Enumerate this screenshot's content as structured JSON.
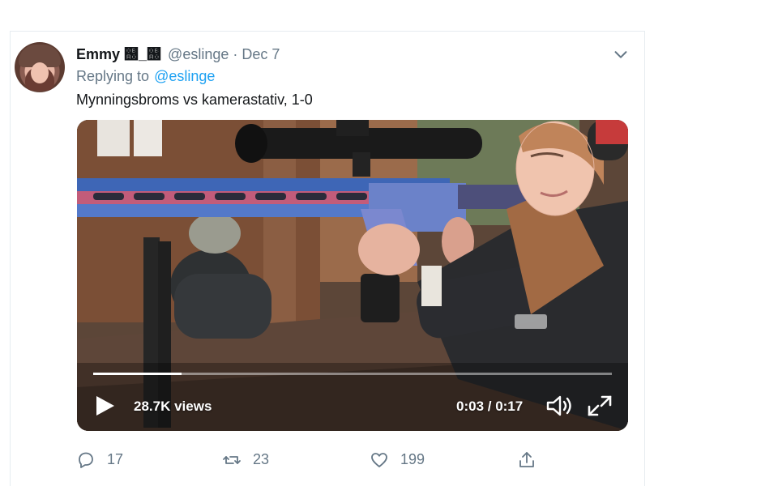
{
  "tweet": {
    "author_name": "Emmy ஠_஠",
    "author_handle": "@eslinge",
    "separator": "·",
    "date": "Dec 7",
    "replying_label": "Replying to",
    "replying_handle": "@eslinge",
    "text": "Mynningsbroms vs kamerastativ, 1-0"
  },
  "video": {
    "views": "28.7K views",
    "time": "0:03 / 0:17",
    "progress_fraction": 0.17
  },
  "actions": {
    "reply_count": "17",
    "retweet_count": "23",
    "like_count": "199"
  },
  "icons": [
    "avatar-image",
    "chevron-down-icon",
    "play-icon",
    "volume-icon",
    "expand-icon",
    "reply-icon",
    "retweet-icon",
    "like-icon",
    "share-icon"
  ],
  "colors": {
    "link": "#1da1f2",
    "muted": "#657786",
    "text": "#14171a",
    "border": "#e6ecf0"
  }
}
